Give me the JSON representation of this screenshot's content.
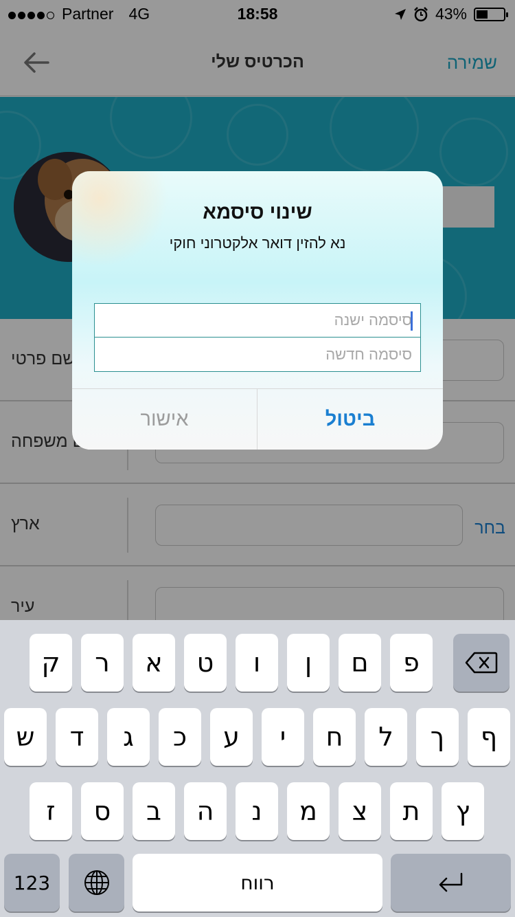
{
  "status_bar": {
    "carrier": "Partner",
    "network": "4G",
    "time": "18:58",
    "battery": "43%",
    "battery_level": 0.43
  },
  "navbar": {
    "title": "הכרטיס שלי",
    "save_label": "שמירה",
    "back_icon": "arrow-left-icon"
  },
  "form": {
    "rows": [
      {
        "label": "שם פרטי"
      },
      {
        "label": "שם משפחה"
      },
      {
        "label": "ארץ",
        "action": "בחר"
      },
      {
        "label": "עיר"
      }
    ]
  },
  "dialog": {
    "title": "שינוי סיסמא",
    "message": "נא להזין דואר אלקטרוני חוקי",
    "old_password_placeholder": "סיסמה ישנה",
    "new_password_placeholder": "סיסמה חדשה",
    "confirm_label": "אישור",
    "cancel_label": "ביטול"
  },
  "keyboard": {
    "row1": [
      "ק",
      "ר",
      "א",
      "ט",
      "ו",
      "ן",
      "ם",
      "פ"
    ],
    "row2": [
      "ש",
      "ד",
      "ג",
      "כ",
      "ע",
      "י",
      "ח",
      "ל",
      "ך",
      "ף"
    ],
    "row3": [
      "ז",
      "ס",
      "ב",
      "ה",
      "נ",
      "מ",
      "צ",
      "ת",
      "ץ"
    ],
    "numbers_label": "123",
    "space_label": "רווח",
    "backspace_icon": "backspace-icon",
    "globe_icon": "globe-icon",
    "return_icon": "return-icon"
  },
  "colors": {
    "accent": "#1aa6c4",
    "header": "#1eaec6",
    "link": "#1a7fd1"
  }
}
